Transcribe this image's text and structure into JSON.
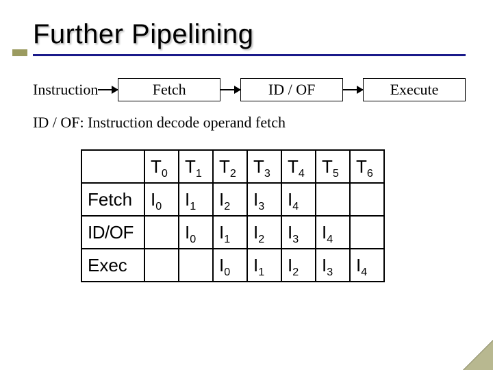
{
  "title": "Further Pipelining",
  "stages": {
    "label": "Instruction",
    "s1": "Fetch",
    "s2": "ID / OF",
    "s3": "Execute"
  },
  "note": "ID / OF: Instruction decode operand fetch",
  "table": {
    "colPrefix": "T",
    "cols": [
      "0",
      "1",
      "2",
      "3",
      "4",
      "5",
      "6"
    ],
    "rows": [
      {
        "label": "Fetch",
        "cells": [
          "I0",
          "I1",
          "I2",
          "I3",
          "I4",
          "",
          ""
        ]
      },
      {
        "label": "ID/OF",
        "cells": [
          "",
          "I0",
          "I1",
          "I2",
          "I3",
          "I4",
          ""
        ]
      },
      {
        "label": "Exec",
        "cells": [
          "",
          "",
          "I0",
          "I1",
          "I2",
          "I3",
          "I4"
        ]
      }
    ]
  }
}
